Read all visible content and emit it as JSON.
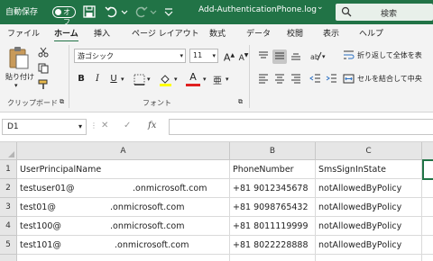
{
  "titlebar": {
    "autosave_label": "自動保存",
    "autosave_state": "オフ",
    "filename": "Add-AuthenticationPhone.log",
    "filename_dropdown": "⌄",
    "search_label": "検索"
  },
  "tabs": [
    "ファイル",
    "ホーム",
    "挿入",
    "ページ レイアウト",
    "数式",
    "データ",
    "校閲",
    "表示",
    "ヘルプ"
  ],
  "ribbon": {
    "clipboard": {
      "paste_label": "貼り付け",
      "group_label": "クリップボード"
    },
    "font": {
      "font_name": "游ゴシック",
      "font_size": "11",
      "grow": "A",
      "shrink": "A",
      "bold": "B",
      "italic": "I",
      "underline": "U",
      "font_color": "A",
      "group_label": "フォント"
    },
    "alignment": {
      "wrap_text": "折り返して全体を表",
      "merge_center": "セルを結合して中央"
    }
  },
  "formula_bar": {
    "name_box": "D1",
    "cancel": "✕",
    "enter": "✓",
    "fx": "fx",
    "value": ""
  },
  "sheet": {
    "columns": [
      "A",
      "B",
      "C"
    ],
    "rows": [
      "1",
      "2",
      "3",
      "4",
      "5"
    ],
    "cells": [
      [
        "UserPrincipalName",
        "PhoneNumber",
        "SmsSignInState"
      ],
      [
        "testuser01@",
        "+81 9012345678",
        "notAllowedByPolicy"
      ],
      [
        "test01@",
        "+81 9098765432",
        "notAllowedByPolicy"
      ],
      [
        "test100@",
        "+81 8011119999",
        "notAllowedByPolicy"
      ],
      [
        "test101@",
        "+81 8022228888",
        "notAllowedByPolicy"
      ]
    ],
    "domain_suffix": [
      ".onmicrosoft.com",
      ".onmicrosoft.com",
      ".onmicrosoft.com",
      ".onmicrosoft.com"
    ]
  }
}
